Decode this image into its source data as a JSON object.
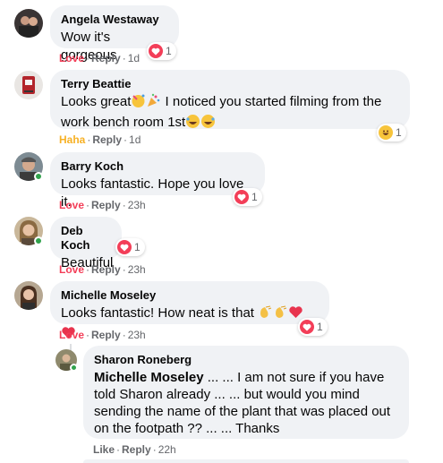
{
  "colors": {
    "love": "#f33e58",
    "haha": "#f7b125",
    "meta": "#65676b",
    "bubble": "#f0f2f5",
    "online": "#31a24c"
  },
  "comments": [
    {
      "author": "Angela Westaway",
      "text": "Wow it's gorgeous",
      "reaction_label": "Love",
      "reply_label": "Reply",
      "time": "1d",
      "reaction_icon": "heart-icon",
      "reaction_count": "1"
    },
    {
      "author": "Terry Beattie",
      "text_line1": "Looks great",
      "text_line1_rest": " I noticed you started filming from the",
      "text_line2": "work bench room 1st",
      "reaction_label": "Haha",
      "reply_label": "Reply",
      "time": "1d",
      "reaction_icon": "haha-icon",
      "reaction_count": "1"
    },
    {
      "author": "Barry Koch",
      "text": "Looks fantastic. Hope you love it.",
      "reaction_label": "Love",
      "reply_label": "Reply",
      "time": "23h",
      "reaction_icon": "heart-icon",
      "reaction_count": "1"
    },
    {
      "author": "Deb Koch",
      "text": "Beautiful",
      "reaction_label": "Love",
      "reply_label": "Reply",
      "time": "23h",
      "reaction_icon": "heart-icon",
      "reaction_count": "1"
    },
    {
      "author": "Michelle Moseley",
      "text": "Looks fantastic! How neat is that",
      "reaction_label": "Love",
      "reply_label": "Reply",
      "time": "23h",
      "reaction_icon": "heart-icon",
      "reaction_count": "1"
    }
  ],
  "reply": {
    "author": "Sharon Roneberg",
    "mention": "Michelle Moseley",
    "text_line1": " ... ... I am not sure if you have",
    "text_line2": "told Sharon already ... ... but would you mind",
    "text_line3": "sending the name of the plant that was placed out",
    "text_line4": "on the footpath ?? ... ... Thanks",
    "reaction_label": "Like",
    "reply_label": "Reply",
    "time": "22h"
  }
}
